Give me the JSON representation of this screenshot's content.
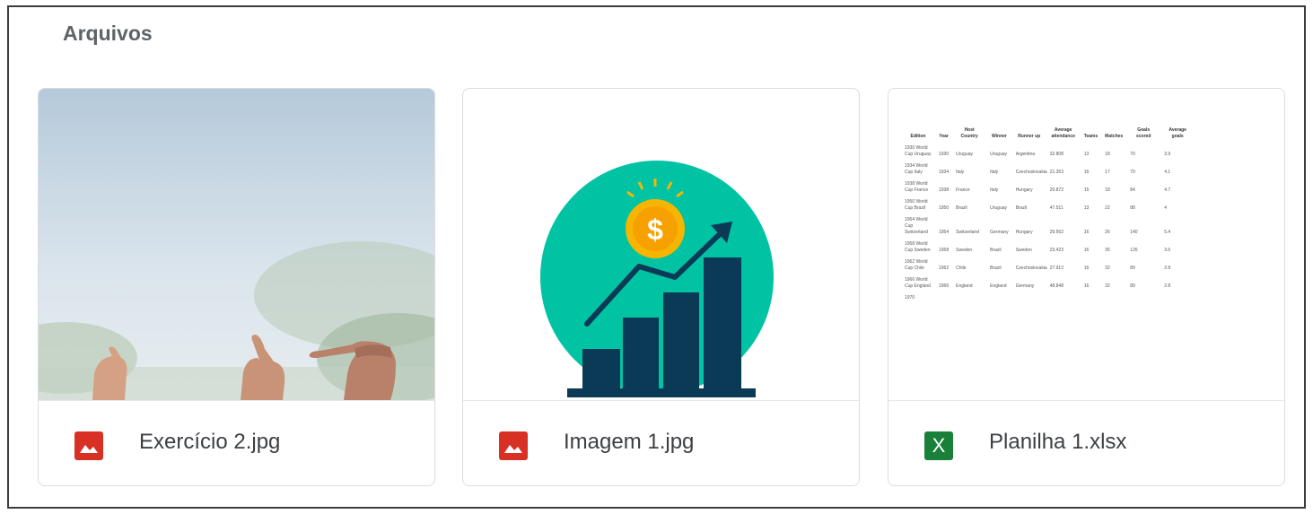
{
  "section": {
    "title": "Arquivos"
  },
  "colors": {
    "image_icon": "#d93025",
    "sheet_icon": "#188038",
    "title": "#5f6368",
    "text": "#3c4043",
    "teal": "#00c3a4",
    "navy": "#0a3a55",
    "gold": "#f7b500"
  },
  "files": [
    {
      "name": "Exercício 2.jpg",
      "icon": "image-file-icon",
      "preview": "photo-thumbs-up"
    },
    {
      "name": "Imagem 1.jpg",
      "icon": "image-file-icon",
      "preview": "growth-chart-illustration"
    },
    {
      "name": "Planilha 1.xlsx",
      "icon": "excel-file-icon",
      "icon_letter": "X",
      "preview": "spreadsheet-table"
    }
  ],
  "sheet": {
    "headers": [
      "Edition",
      "Year",
      "Host Country",
      "Winner",
      "Runner up",
      "Average attendance",
      "Teams",
      "Matches",
      "Goals scored",
      "Average goals"
    ],
    "rows": [
      [
        "1930 World Cup Uruguay",
        "1930",
        "Uruguay",
        "Uruguay",
        "Argentina",
        "32.808",
        "13",
        "18",
        "70",
        "3.9"
      ],
      [
        "1934 World Cup Italy",
        "1934",
        "Italy",
        "Italy",
        "Czechoslovakia",
        "21.353",
        "16",
        "17",
        "70",
        "4.1"
      ],
      [
        "1938 World Cup France",
        "1938",
        "France",
        "Italy",
        "Hungary",
        "20.872",
        "15",
        "18",
        "84",
        "4.7"
      ],
      [
        "1950 World Cup Brazil",
        "1950",
        "Brazil",
        "Uruguay",
        "Brazil",
        "47.511",
        "13",
        "22",
        "88",
        "4"
      ],
      [
        "1954 World Cup Switzerland",
        "1954",
        "Switzerland",
        "Germany",
        "Hungary",
        "29.562",
        "16",
        "26",
        "140",
        "5.4"
      ],
      [
        "1958 World Cup Sweden",
        "1958",
        "Sweden",
        "Brazil",
        "Sweden",
        "23.423",
        "16",
        "35",
        "126",
        "3.6"
      ],
      [
        "1962 World Cup Chile",
        "1962",
        "Chile",
        "Brazil",
        "Czechoslovakia",
        "27.912",
        "16",
        "32",
        "89",
        "2.8"
      ],
      [
        "1966 World Cup England",
        "1966",
        "England",
        "England",
        "Germany",
        "48.848",
        "16",
        "32",
        "89",
        "2.8"
      ],
      [
        "1970",
        "",
        "",
        "",
        "",
        "",
        "",
        "",
        "",
        ""
      ]
    ]
  }
}
